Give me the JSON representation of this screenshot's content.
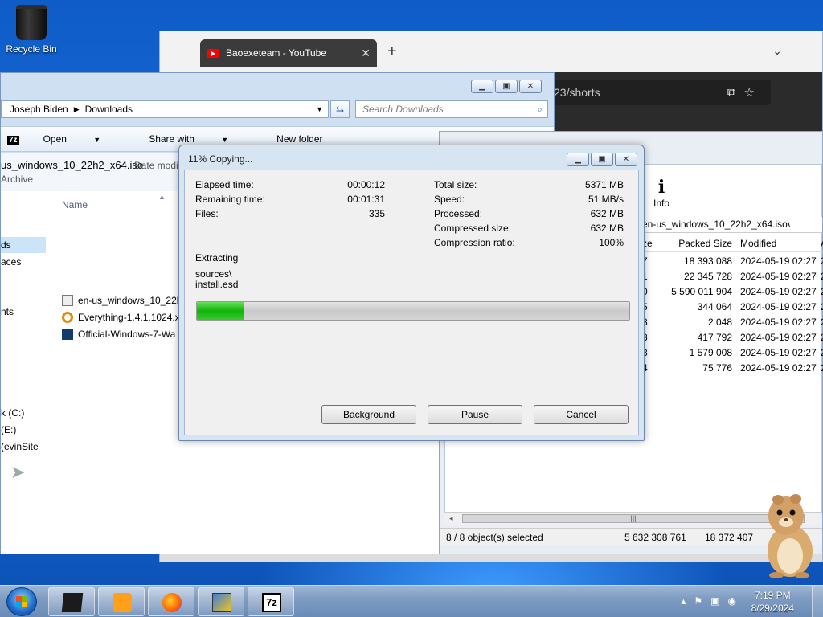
{
  "desktop": {
    "recycle_bin_label": "Recycle Bin"
  },
  "browser": {
    "tab_title": "Baoexeteam - YouTube",
    "tab_close": "✕",
    "new_tab": "+",
    "tab_dropdown": "⌄",
    "url_fragment": "23/shorts"
  },
  "explorer": {
    "breadcrumb": [
      "Joseph Biden",
      "Downloads"
    ],
    "breadcrumb_sep": "▶",
    "search_placeholder": "Search Downloads",
    "toolbar": {
      "open_badge": "7z",
      "open_label": "Open",
      "share_label": "Share with",
      "new_folder_label": "New folder"
    },
    "details": {
      "file_name": "us_windows_10_22h2_x64.iso",
      "date_label": "Date modi",
      "type": "Archive"
    },
    "column_name": "Name",
    "files": [
      "en-us_windows_10_22h...",
      "Everything-1.4.1.1024.x6",
      "Official-Windows-7-Wa"
    ],
    "nav_items": [
      "ds",
      "aces",
      "nts",
      "k (C:)",
      "(E:)",
      "(evinSite"
    ]
  },
  "sevenzip": {
    "info_label": "Info",
    "path": "en-us_windows_10_22h2_x64.iso\\",
    "columns": [
      "ze",
      "Packed Size",
      "Modified",
      "A"
    ],
    "rows": [
      [
        "7",
        "18 393 088",
        "2024-05-19 02:27",
        "2"
      ],
      [
        "1",
        "22 345 728",
        "2024-05-19 02:27",
        "2"
      ],
      [
        "0",
        "5 590 011 904",
        "2024-05-19 02:27",
        "2"
      ],
      [
        "5",
        "344 064",
        "2024-05-19 02:27",
        "2"
      ],
      [
        "8",
        "2 048",
        "2024-05-19 02:27",
        "2"
      ],
      [
        "8",
        "417 792",
        "2024-05-19 02:27",
        "2"
      ],
      [
        "8",
        "1 579 008",
        "2024-05-19 02:27",
        "2"
      ],
      [
        "4",
        "75 776",
        "2024-05-19 02:27",
        "2"
      ]
    ],
    "status": {
      "selected": "8 / 8 object(s) selected",
      "total": "5 632 308 761",
      "packed": "18 372 407"
    }
  },
  "dialog": {
    "title": "11% Copying...",
    "elapsed_label": "Elapsed time:",
    "elapsed_value": "00:00:12",
    "remaining_label": "Remaining time:",
    "remaining_value": "00:01:31",
    "files_label": "Files:",
    "files_value": "335",
    "total_size_label": "Total size:",
    "total_size_value": "5371 MB",
    "speed_label": "Speed:",
    "speed_value": "51 MB/s",
    "processed_label": "Processed:",
    "processed_value": "632 MB",
    "compressed_label": "Compressed size:",
    "compressed_value": "632 MB",
    "ratio_label": "Compression ratio:",
    "ratio_value": "100%",
    "operation": "Extracting",
    "current_dir": "sources\\",
    "current_file": "install.esd",
    "progress_percent": 11,
    "buttons": {
      "background": "Background",
      "pause": "Pause",
      "cancel": "Cancel"
    }
  },
  "taskbar": {
    "time": "7:19 PM",
    "date": "8/29/2024",
    "seven_zip_icon_text": "7z"
  },
  "colors": {
    "progress_fill": "#11b40a",
    "desktop_blue": "#1a63c9",
    "youtube_red": "#ff0000"
  }
}
